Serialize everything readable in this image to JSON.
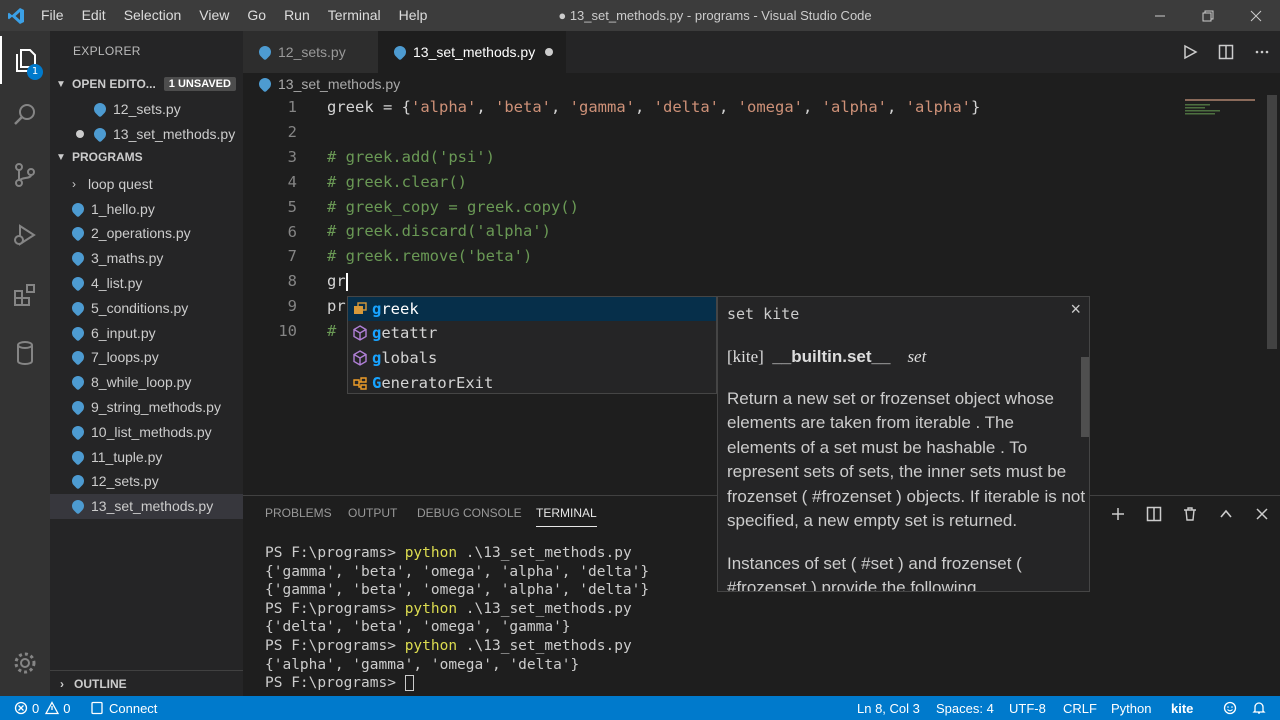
{
  "window": {
    "title": "● 13_set_methods.py - programs - Visual Studio Code",
    "menu": [
      "File",
      "Edit",
      "Selection",
      "View",
      "Go",
      "Run",
      "Terminal",
      "Help"
    ]
  },
  "activity": {
    "badge": "1"
  },
  "sidebar": {
    "title": "EXPLORER",
    "open_editors": {
      "label": "OPEN EDITO...",
      "unsaved": "1 UNSAVED",
      "items": [
        "12_sets.py",
        "13_set_methods.py"
      ]
    },
    "programs": {
      "label": "PROGRAMS",
      "folder": "loop quest",
      "files": [
        "1_hello.py",
        "2_operations.py",
        "3_maths.py",
        "4_list.py",
        "5_conditions.py",
        "6_input.py",
        "7_loops.py",
        "8_while_loop.py",
        "9_string_methods.py",
        "10_list_methods.py",
        "11_tuple.py",
        "12_sets.py",
        "13_set_methods.py"
      ]
    },
    "outline": "OUTLINE"
  },
  "tabs": [
    {
      "label": "12_sets.py"
    },
    {
      "label": "13_set_methods.py"
    }
  ],
  "breadcrumb": "13_set_methods.py",
  "editor": {
    "line_numbers": [
      "1",
      "2",
      "3",
      "4",
      "5",
      "6",
      "7",
      "8",
      "9",
      "10"
    ],
    "line1": {
      "var": "greek = {",
      "s1": "'alpha'",
      "s2": "'beta'",
      "s3": "'gamma'",
      "s4": "'delta'",
      "s5": "'omega'",
      "s6": "'alpha'",
      "s7": "'alpha'",
      "end": "}"
    },
    "line3": "# greek.add('psi')",
    "line4": "# greek.clear()",
    "line5": "# greek_copy = greek.copy()",
    "line6": "# greek.discard('alpha')",
    "line7": "# greek.remove('beta')",
    "line8": "gr",
    "line9": "pr",
    "line10": "#"
  },
  "suggest": {
    "items": [
      {
        "match": "g",
        "rest": "reek"
      },
      {
        "match": "g",
        "rest": "etattr"
      },
      {
        "match": "g",
        "rest": "lobals"
      },
      {
        "match": "G",
        "rest": "eneratorExit"
      }
    ]
  },
  "doc": {
    "header": "set  kite",
    "sig_kite": "[kite]",
    "sig_name": "__builtin.set__",
    "sig_type": "set",
    "body": "Return a new set or frozenset object whose elements are taken from iterable . The elements of a set must be hashable . To represent sets of sets, the inner sets must be frozenset ( #frozenset ) objects. If iterable is not specified, a new empty set is returned.",
    "body2": "Instances of set ( #set ) and frozenset ( #frozenset ) provide the following",
    "close": "×"
  },
  "panel": {
    "tabs": [
      "PROBLEMS",
      "OUTPUT",
      "DEBUG CONSOLE",
      "TERMINAL"
    ],
    "terminal": {
      "prompt": "PS F:\\programs>",
      "cmd_py": "python",
      "cmd_arg": " .\\13_set_methods.py",
      "out1": "{'gamma', 'beta', 'omega', 'alpha', 'delta'}",
      "out2": "{'gamma', 'beta', 'omega', 'alpha', 'delta'}",
      "out3": "{'delta', 'beta', 'omega', 'gamma'}",
      "out4": "{'alpha', 'gamma', 'omega', 'delta'}"
    }
  },
  "status": {
    "errors": "0",
    "warnings": "0",
    "connect": "Connect",
    "position": "Ln 8, Col 3",
    "spaces": "Spaces: 4",
    "encoding": "UTF-8",
    "eol": "CRLF",
    "language": "Python",
    "kite": "kite"
  },
  "colors": {
    "accent": "#007acc",
    "string": "#ce9178",
    "comment": "#6a9955",
    "match": "#18a3ff"
  }
}
